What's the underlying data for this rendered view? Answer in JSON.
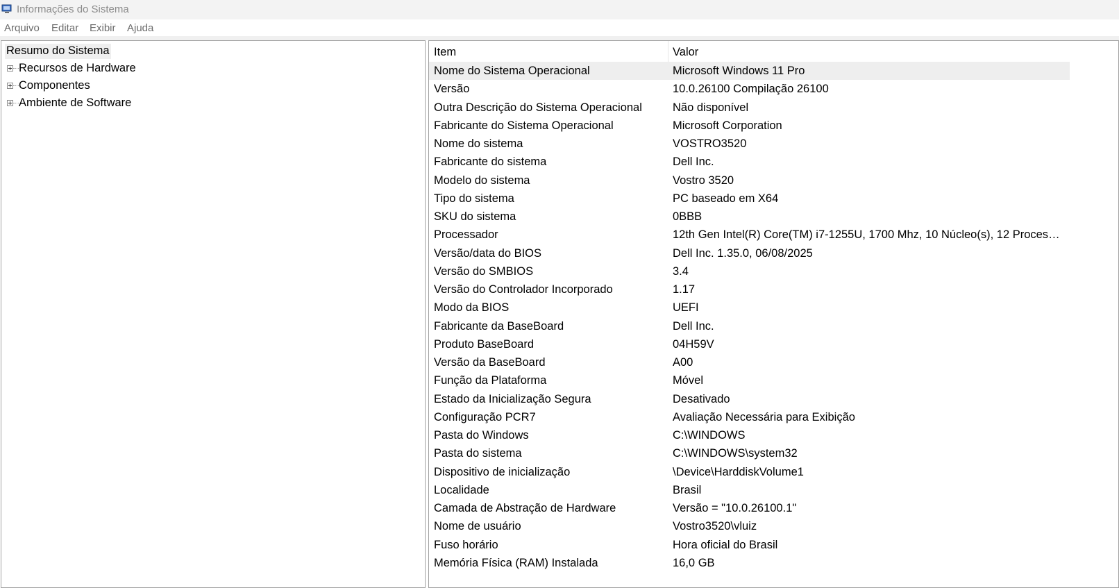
{
  "window": {
    "title": "Informações do Sistema",
    "icon": "system-info-icon"
  },
  "menu": [
    "Arquivo",
    "Editar",
    "Exibir",
    "Ajuda"
  ],
  "tree": {
    "root": "Resumo do Sistema",
    "items": [
      "Recursos de Hardware",
      "Componentes",
      "Ambiente de Software"
    ]
  },
  "table": {
    "columns": [
      "Item",
      "Valor"
    ],
    "selected_row": 0,
    "rows": [
      {
        "item": "Nome do Sistema Operacional",
        "value": "Microsoft Windows 11 Pro"
      },
      {
        "item": "Versão",
        "value": "10.0.26100 Compilação 26100"
      },
      {
        "item": "Outra Descrição do Sistema Operacional",
        "value": "Não disponível"
      },
      {
        "item": "Fabricante do Sistema Operacional",
        "value": "Microsoft Corporation"
      },
      {
        "item": "Nome do sistema",
        "value": "VOSTRO3520"
      },
      {
        "item": "Fabricante do sistema",
        "value": "Dell Inc."
      },
      {
        "item": "Modelo do sistema",
        "value": "Vostro 3520"
      },
      {
        "item": "Tipo do sistema",
        "value": "PC baseado em X64"
      },
      {
        "item": "SKU do sistema",
        "value": "0BBB"
      },
      {
        "item": "Processador",
        "value": "12th Gen Intel(R) Core(TM) i7-1255U, 1700 Mhz, 10 Núcleo(s), 12 Processa..."
      },
      {
        "item": "Versão/data do BIOS",
        "value": "Dell Inc. 1.35.0, 06/08/2025"
      },
      {
        "item": "Versão do SMBIOS",
        "value": "3.4"
      },
      {
        "item": "Versão do Controlador Incorporado",
        "value": "1.17"
      },
      {
        "item": "Modo da BIOS",
        "value": "UEFI"
      },
      {
        "item": "Fabricante da BaseBoard",
        "value": "Dell Inc."
      },
      {
        "item": "Produto BaseBoard",
        "value": "04H59V"
      },
      {
        "item": "Versão da BaseBoard",
        "value": "A00"
      },
      {
        "item": "Função da Plataforma",
        "value": "Móvel"
      },
      {
        "item": "Estado da Inicialização Segura",
        "value": "Desativado"
      },
      {
        "item": "Configuração PCR7",
        "value": "Avaliação Necessária para Exibição"
      },
      {
        "item": "Pasta do Windows",
        "value": "C:\\WINDOWS"
      },
      {
        "item": "Pasta do sistema",
        "value": "C:\\WINDOWS\\system32"
      },
      {
        "item": "Dispositivo de inicialização",
        "value": "\\Device\\HarddiskVolume1"
      },
      {
        "item": "Localidade",
        "value": "Brasil"
      },
      {
        "item": "Camada de Abstração de Hardware",
        "value": "Versão = \"10.0.26100.1\""
      },
      {
        "item": "Nome de usuário",
        "value": "Vostro3520\\vluiz"
      },
      {
        "item": "Fuso horário",
        "value": "Hora oficial do Brasil"
      },
      {
        "item": "Memória Física (RAM) Instalada",
        "value": "16,0 GB"
      }
    ]
  }
}
